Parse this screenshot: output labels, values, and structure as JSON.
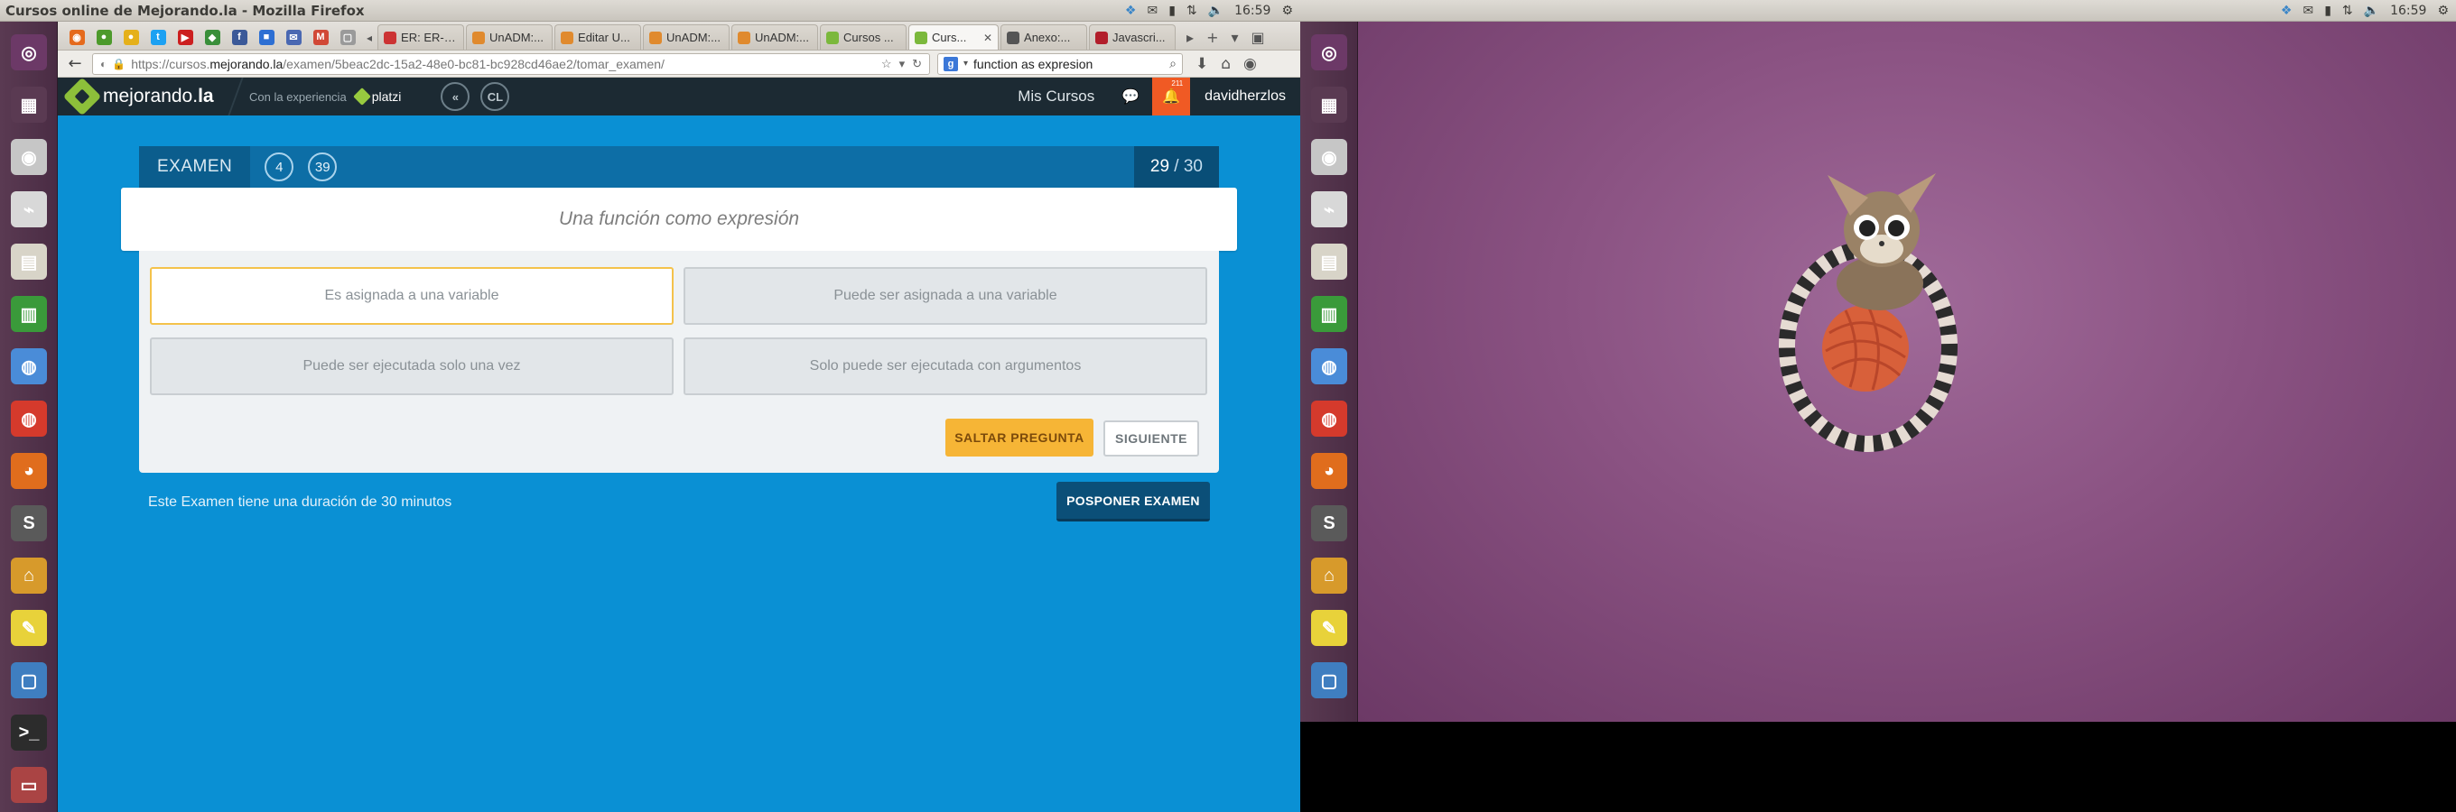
{
  "left_panel": {
    "title": "Cursos online de Mejorando.la - Mozilla Firefox",
    "time": "16:59"
  },
  "right_panel": {
    "time": "16:59"
  },
  "colors": {
    "site_bg": "#0a90d4",
    "header_bg": "#1c2a33",
    "accent_orange": "#f05a24",
    "skip_yellow": "#f6b536",
    "postpone_blue": "#0b4f78",
    "launcher_bg": "#5a3a52"
  },
  "pinned_tabs": [
    {
      "icon": "orange-app-icon",
      "color": "#e56a1c",
      "glyph": "◉"
    },
    {
      "icon": "green-app-icon",
      "color": "#4d9a2b",
      "glyph": "●"
    },
    {
      "icon": "yellow-app-icon",
      "color": "#e5b01a",
      "glyph": "●"
    },
    {
      "icon": "twitter-icon",
      "color": "#1da1f2",
      "glyph": "t"
    },
    {
      "icon": "youtube-icon",
      "color": "#cc1f1f",
      "glyph": "▶"
    },
    {
      "icon": "maps-icon",
      "color": "#3a8f3a",
      "glyph": "◆"
    },
    {
      "icon": "facebook-icon",
      "color": "#3b5998",
      "glyph": "f"
    },
    {
      "icon": "blue-app-icon",
      "color": "#2d6fd3",
      "glyph": "■"
    },
    {
      "icon": "mail-icon",
      "color": "#4a68b2",
      "glyph": "✉"
    },
    {
      "icon": "gmail-icon",
      "color": "#d14836",
      "glyph": "M"
    },
    {
      "icon": "grey-app-icon",
      "color": "#9a9a9a",
      "glyph": "▢"
    }
  ],
  "tabs": [
    {
      "label": "ER: ER-S...",
      "icon_color": "#c33",
      "active": false
    },
    {
      "label": "UnADM:...",
      "icon_color": "#e08a2e",
      "active": false
    },
    {
      "label": "Editar U...",
      "icon_color": "#e08a2e",
      "active": false
    },
    {
      "label": "UnADM:...",
      "icon_color": "#e08a2e",
      "active": false
    },
    {
      "label": "UnADM:...",
      "icon_color": "#e08a2e",
      "active": false
    },
    {
      "label": "Cursos ...",
      "icon_color": "#7bb83c",
      "active": false
    },
    {
      "label": "Curs...",
      "icon_color": "#7bb83c",
      "active": true
    },
    {
      "label": "Anexo:...",
      "icon_color": "#555",
      "active": false
    },
    {
      "label": "Javascri...",
      "icon_color": "#b21e2b",
      "active": false
    }
  ],
  "urlbar": {
    "scheme": "https://cursos.",
    "host": "mejorando.la",
    "path": "/examen/5beac2dc-15a2-48e0-bc81-bc928cd46ae2/tomar_examen/"
  },
  "searchbar": {
    "value": "function as expresion"
  },
  "site": {
    "logo_prefix": "mejorando.",
    "logo_suffix": "la",
    "experience_label": "Con la experiencia",
    "platzi_label": "platzi",
    "circle_1": "«",
    "circle_2": "CL",
    "mis_cursos": "Mis Cursos",
    "notification_count": "211",
    "username": "davidherzlos"
  },
  "exam": {
    "label": "EXAMEN",
    "circle_a": "4",
    "circle_b": "39",
    "current": "29",
    "separator": " / ",
    "total": "30",
    "question": "Una función como expresión",
    "answers": [
      {
        "text": "Es asignada a una variable",
        "selected": true
      },
      {
        "text": "Puede ser asignada a una variable",
        "selected": false
      },
      {
        "text": "Puede ser ejecutada solo una vez",
        "selected": false
      },
      {
        "text": "Solo puede ser ejecutada con argumentos",
        "selected": false
      }
    ],
    "skip_label": "SALTAR PREGUNTA",
    "next_label": "SIGUIENTE",
    "duration_text": "Este Examen tiene una duración de 30 minutos",
    "postpone_label": "POSPONER EXAMEN"
  },
  "launcher_items": [
    {
      "icon": "ubuntu-logo-icon",
      "color": "#6c3967"
    },
    {
      "icon": "workspace-icon",
      "color": "#5a3a52"
    },
    {
      "icon": "disc-icon",
      "color": "#c6c6c6"
    },
    {
      "icon": "usb-icon",
      "color": "#d8d8d8"
    },
    {
      "icon": "files-icon",
      "color": "#d8d4c8"
    },
    {
      "icon": "spreadsheet-icon",
      "color": "#3a9a3a"
    },
    {
      "icon": "chromium-icon",
      "color": "#4a8cd8"
    },
    {
      "icon": "chrome-icon",
      "color": "#d53a2c"
    },
    {
      "icon": "firefox-icon",
      "color": "#e06d1d"
    },
    {
      "icon": "sublime-icon",
      "color": "#5a5a5a"
    },
    {
      "icon": "home-icon",
      "color": "#d79a2b"
    },
    {
      "icon": "notes-icon",
      "color": "#e8d23a"
    },
    {
      "icon": "document-icon",
      "color": "#3f7ec0"
    },
    {
      "icon": "terminal-icon",
      "color": "#2c2c2c"
    },
    {
      "icon": "scanner-icon",
      "color": "#a44"
    }
  ]
}
